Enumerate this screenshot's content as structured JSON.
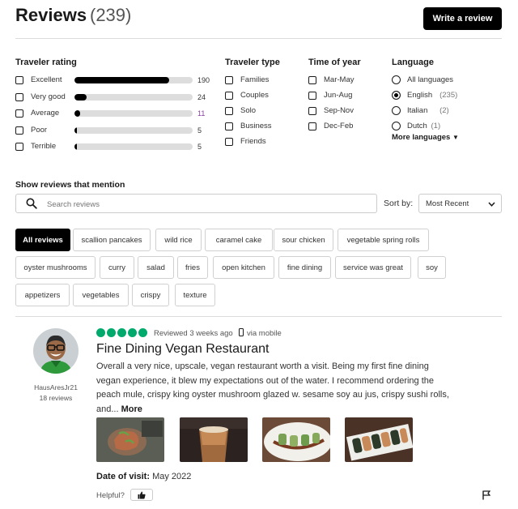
{
  "header": {
    "title": "Reviews",
    "count": "(239)",
    "write_button": "Write a review"
  },
  "traveler_rating": {
    "heading": "Traveler rating",
    "rows": [
      {
        "label": "Excellent",
        "count": "190",
        "fraction": 0.8
      },
      {
        "label": "Very good",
        "count": "24",
        "fraction": 0.1
      },
      {
        "label": "Average",
        "count": "11",
        "fraction": 0.05
      },
      {
        "label": "Poor",
        "count": "5",
        "fraction": 0.02
      },
      {
        "label": "Terrible",
        "count": "5",
        "fraction": 0.02
      }
    ]
  },
  "traveler_type": {
    "heading": "Traveler type",
    "items": [
      "Families",
      "Couples",
      "Solo",
      "Business",
      "Friends"
    ]
  },
  "time_of_year": {
    "heading": "Time of year",
    "items": [
      "Mar-May",
      "Jun-Aug",
      "Sep-Nov",
      "Dec-Feb"
    ]
  },
  "language": {
    "heading": "Language",
    "items": [
      {
        "label": "All languages",
        "extra": "",
        "selected": false
      },
      {
        "label": "English",
        "extra": "(235)",
        "selected": true
      },
      {
        "label": "Italian",
        "extra": "(2)",
        "selected": false
      },
      {
        "label": "Dutch",
        "extra": "(1)",
        "selected": false
      }
    ],
    "more": "More languages"
  },
  "mention": {
    "heading": "Show reviews that mention",
    "search_placeholder": "Search reviews",
    "sort_label": "Sort by:",
    "sort_value": "Most Recent"
  },
  "chips": [
    "All reviews",
    "scallion pancakes",
    "wild rice",
    "caramel cake",
    "sour chicken",
    "vegetable spring rolls",
    "oyster mushrooms",
    "curry",
    "salad",
    "fries",
    "open kitchen",
    "fine dining",
    "service was great",
    "soy",
    "appetizers",
    "vegetables",
    "crispy",
    "texture"
  ],
  "review": {
    "username": "HausAresJr21",
    "user_reviews": "18 reviews",
    "rating": 5,
    "date": "Reviewed 3 weeks ago",
    "via": "via mobile",
    "title": "Fine Dining Vegan Restaurant",
    "body": "Overall a very nice, upscale, vegan restaurant worth a visit. Being my first fine dining vegan experience, it blew my expectations out of the water. I recommend ordering the peach mule, crispy king oyster mushroom glazed w. sesame soy au jus, crispy sushi rolls, and...",
    "more": "More",
    "date_of_visit_label": "Date of visit:",
    "date_of_visit": "May 2022",
    "helpful": "Helpful?"
  },
  "colors": {
    "accent": "#000000",
    "rating_green": "#00aa6c"
  }
}
